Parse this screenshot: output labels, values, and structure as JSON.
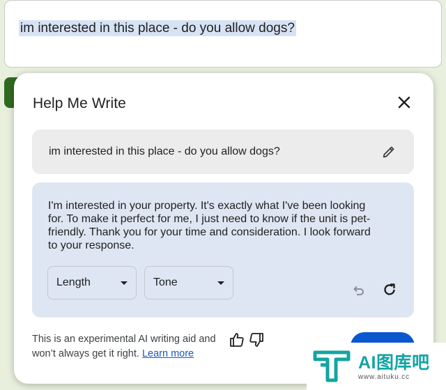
{
  "page": {
    "textarea_value": "im interested in this place - do you allow dogs?"
  },
  "dialog": {
    "title": "Help Me Write",
    "prompt": "im interested in this place - do you allow dogs?",
    "result": "I'm interested in your property. It's exactly what I've been looking for. To make it perfect for me, I just need to know if the unit is pet-friendly. Thank you for your time and consideration. I look forward to your response.",
    "length_label": "Length",
    "tone_label": "Tone",
    "disclaimer": "This is an experimental AI writing aid and won’t always get it right.",
    "learn_more": "Learn more",
    "icons": [
      "close-icon",
      "pencil-icon",
      "chevron-down-icon",
      "undo-icon",
      "redo-icon",
      "thumb-up-icon",
      "thumb-down-icon"
    ]
  },
  "watermark": {
    "brand": "AI图库吧",
    "url": "www.aituku.cc"
  },
  "colors": {
    "background": "#e9efdd",
    "result_bg": "#dfe6f3",
    "prompt_bg": "#ececec",
    "accent": "#0b57d0",
    "link": "#1a57c4",
    "brand": "#14a4a4"
  }
}
